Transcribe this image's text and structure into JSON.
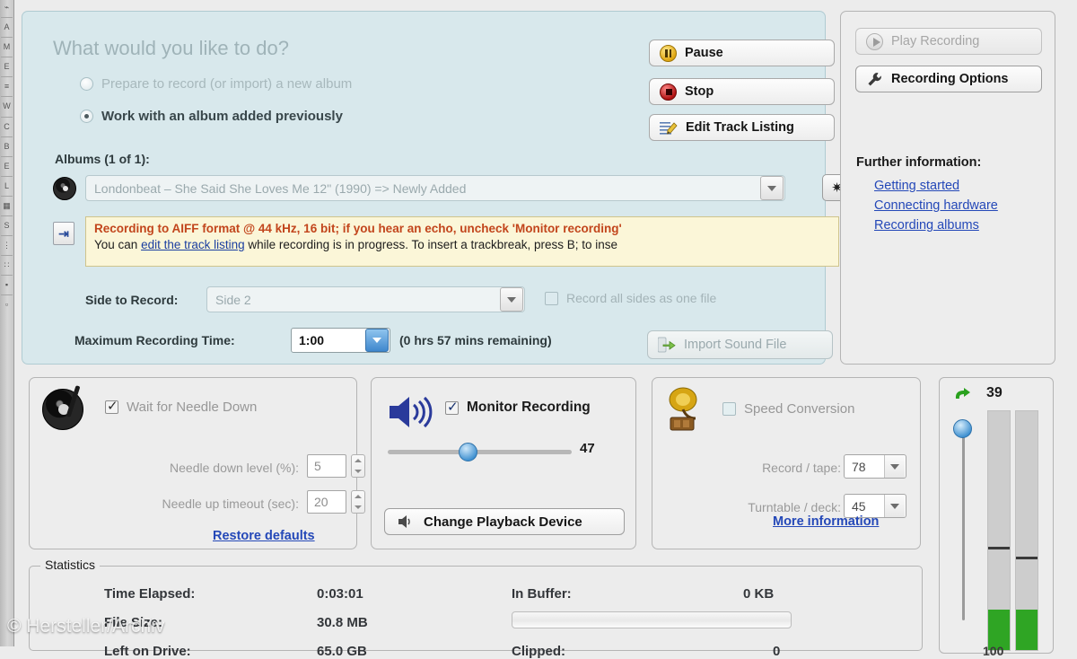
{
  "left_strip": {
    "glyphs": [
      "⌁",
      "A",
      "M",
      "E",
      "≡",
      "W",
      "C",
      "B",
      "E",
      "L",
      "▦",
      "S",
      "⋮",
      "∷",
      "▪",
      "▫"
    ]
  },
  "main": {
    "heading": "What would you like to do?",
    "radio_options": [
      {
        "label": "Prepare to record (or import) a new album",
        "selected": false
      },
      {
        "label": "Work with an album added previously",
        "selected": true
      }
    ],
    "albums_label": "Albums (1 of 1):",
    "album_value": "Londonbeat – She Said She Loves Me 12\" (1990) => Newly Added",
    "gear_glyph": "✷",
    "notification": {
      "icon_glyph": "⇥",
      "line1": "Recording to AIFF format @ 44 kHz, 16 bit; if you hear an echo, uncheck 'Monitor recording'",
      "line2_before": "You can ",
      "line2_link": "edit the track listing",
      "line2_after": " while recording is in progress.  To insert a trackbreak, press B; to inse"
    },
    "side_to_record": {
      "label": "Side to Record:",
      "value": "Side 2"
    },
    "record_all_sides": {
      "label": "Record all sides as one file",
      "checked": false
    },
    "max_recording_time": {
      "label": "Maximum Recording Time:",
      "value": "1:00"
    },
    "remaining": "(0 hrs 57 mins remaining)",
    "buttons": {
      "pause": "Pause",
      "stop": "Stop",
      "edit_track_listing": "Edit Track Listing",
      "import_sound_file": "Import Sound File"
    }
  },
  "sidebar": {
    "play_recording": "Play Recording",
    "recording_options": "Recording Options",
    "further_title": "Further information:",
    "links": [
      "Getting started",
      "Connecting hardware",
      "Recording albums"
    ]
  },
  "needle_panel": {
    "checkbox": {
      "label": "Wait for Needle Down",
      "checked": true
    },
    "down_level_label": "Needle down level (%):",
    "down_level_value": "5",
    "up_timeout_label": "Needle up timeout (sec):",
    "up_timeout_value": "20",
    "restore_link": "Restore defaults"
  },
  "monitor_panel": {
    "checkbox": {
      "label": "Monitor Recording",
      "checked": true
    },
    "volume_value": "47",
    "volume_percent": 47,
    "change_device_button": "Change Playback Device"
  },
  "speed_panel": {
    "checkbox": {
      "label": "Speed Conversion",
      "checked": false
    },
    "record_tape_label": "Record / tape:",
    "record_tape_value": "78",
    "turntable_label": "Turntable / deck:",
    "turntable_value": "45",
    "more_info_link": "More information"
  },
  "statistics": {
    "legend": "Statistics",
    "rows_left": [
      {
        "key": "Time Elapsed:",
        "value": "0:03:01"
      },
      {
        "key": "File Size:",
        "value": "30.8 MB"
      },
      {
        "key": "Left on Drive:",
        "value": "65.0 GB"
      }
    ],
    "rows_right": [
      {
        "key": "In Buffer:",
        "value": "0 KB"
      },
      {
        "key": "Clipped:",
        "value": "0"
      }
    ],
    "buffer_percent": 0
  },
  "vu_meter": {
    "reset_icon": "reset-arrow",
    "value": "39",
    "bottom_label": "100",
    "slider_percent": 5,
    "left_level_percent": 17,
    "right_level_percent": 17,
    "left_peak_percent": 42,
    "right_peak_percent": 38
  },
  "watermark": "© Hersteller/Archiv",
  "colors": {
    "panel_cyan": "#d8e8ec",
    "panel_grey": "#ededed",
    "link_blue": "#2448b8",
    "warning_red": "#c2451c",
    "notify_bg": "#fbf6d8",
    "meter_green": "#2fa524",
    "accent_blue": "#3d8fd0"
  }
}
